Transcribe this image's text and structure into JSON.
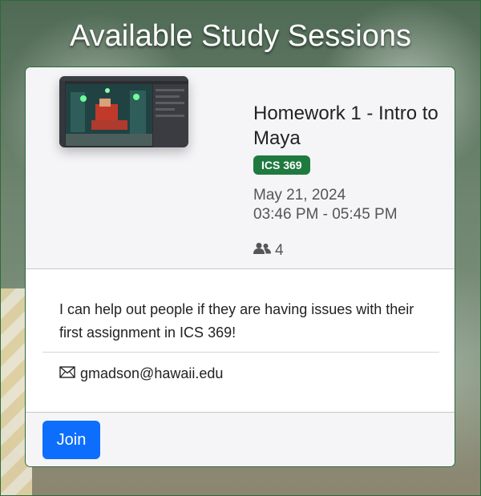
{
  "page": {
    "title": "Available Study Sessions"
  },
  "session": {
    "title": "Homework 1 - Intro to Maya",
    "course": "ICS 369",
    "date": "May 21, 2024",
    "time": "03:46 PM - 05:45 PM",
    "attendee_count": "4",
    "description": "I can help out people if they are having issues with their first assignment in ICS 369!",
    "email": "gmadson@hawaii.edu",
    "join_label": "Join"
  },
  "colors": {
    "badge": "#1f7a3f",
    "join_button": "#0d6efd",
    "card_border": "#2a6b3a"
  },
  "icons": {
    "attendees": "people-icon",
    "email": "envelope-icon"
  }
}
